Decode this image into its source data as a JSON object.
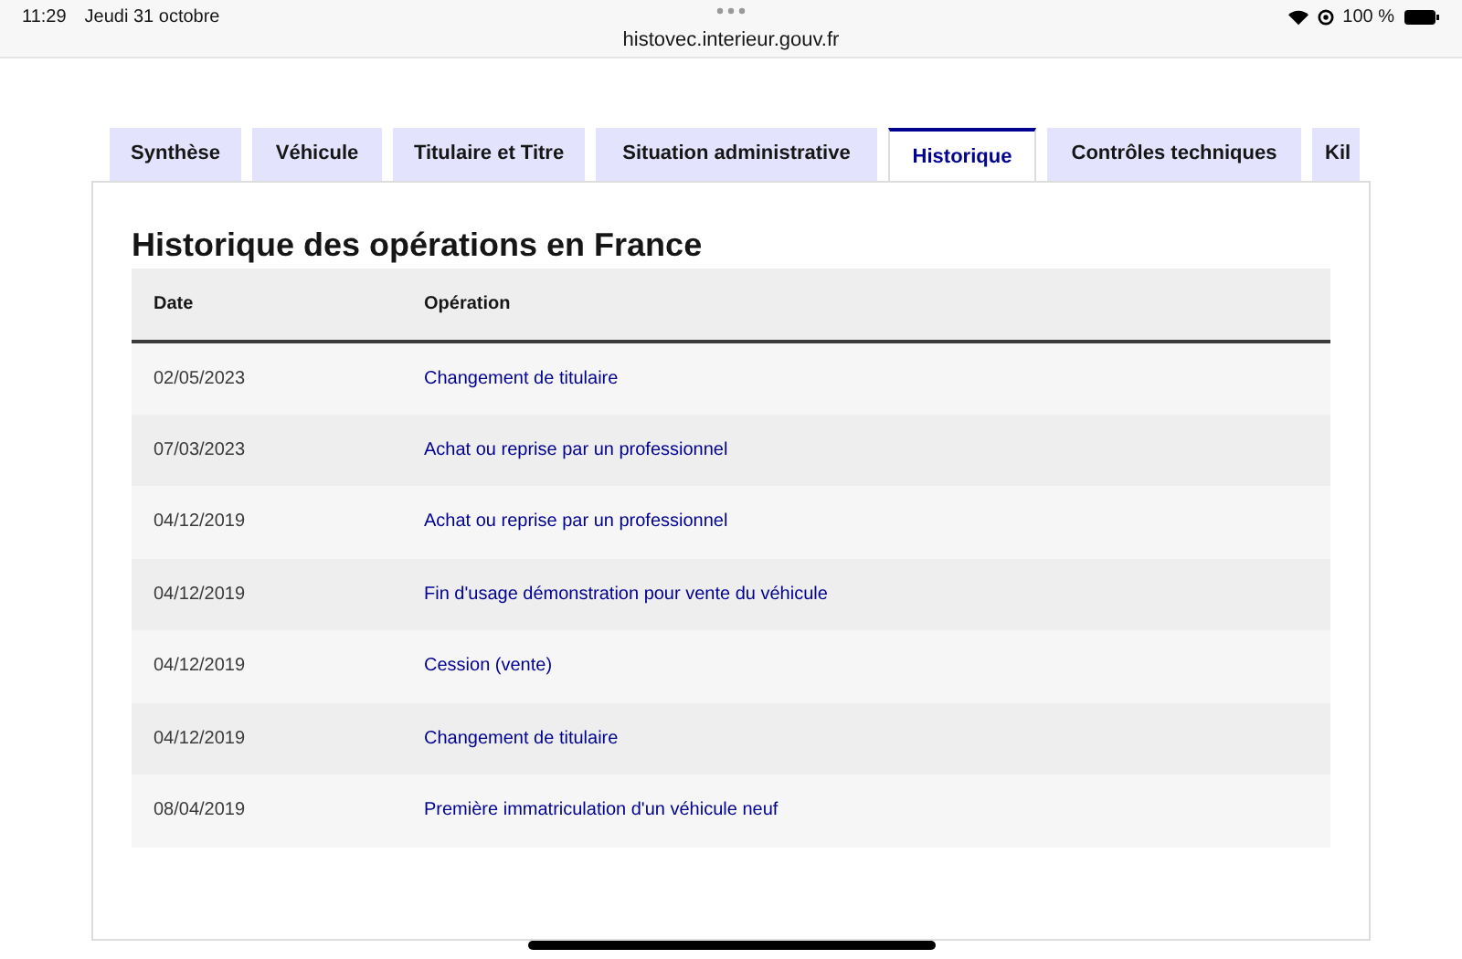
{
  "status_bar": {
    "time": "11:29",
    "date": "Jeudi 31 octobre",
    "battery": "100 %"
  },
  "address_bar": {
    "url": "histovec.interieur.gouv.fr"
  },
  "tabs": [
    {
      "label": "Synthèse",
      "selected": false
    },
    {
      "label": "Véhicule",
      "selected": false
    },
    {
      "label": "Titulaire et Titre",
      "selected": false
    },
    {
      "label": "Situation administrative",
      "selected": false
    },
    {
      "label": "Historique",
      "selected": true
    },
    {
      "label": "Contrôles techniques",
      "selected": false
    },
    {
      "label": "Kil",
      "selected": false
    }
  ],
  "section_title": "Historique des opérations en France",
  "table": {
    "columns": [
      "Date",
      "Opération"
    ],
    "rows": [
      [
        "02/05/2023",
        "Changement de titulaire"
      ],
      [
        "07/03/2023",
        "Achat ou reprise par un professionnel"
      ],
      [
        "04/12/2019",
        "Achat ou reprise par un professionnel"
      ],
      [
        "04/12/2019",
        "Fin d'usage démonstration pour vente du véhicule"
      ],
      [
        "04/12/2019",
        "Cession (vente)"
      ],
      [
        "04/12/2019",
        "Changement de titulaire"
      ],
      [
        "08/04/2019",
        "Première immatriculation d'un véhicule neuf"
      ]
    ]
  }
}
